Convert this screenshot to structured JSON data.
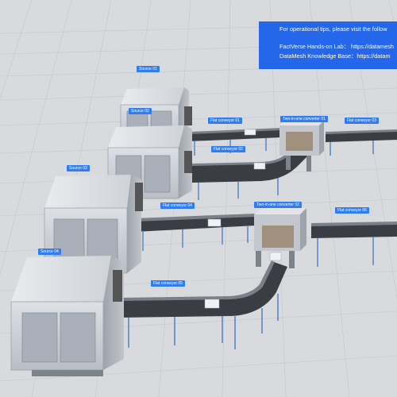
{
  "tip_panel": {
    "line1": "For operational tips, please visit the follow",
    "line2": "FactVerse Hands-on Lab： https://datamesh",
    "line3": "DataMesh Knowledge Base：https://datam"
  },
  "labels": {
    "source01": "Source 01",
    "source02": "Source 02",
    "source03": "Source 03",
    "source04": "Source 04",
    "conveyor01": "Flat conveyor 01",
    "conveyor02": "Flat conveyor 02",
    "conveyor03": "Flat conveyor 03",
    "conveyor04": "Flat conveyor 04",
    "conveyor05": "Flat conveyor 05",
    "conveyor06": "Flat conveyor 06",
    "converter01": "Two-in-one converter 01",
    "converter02": "Two-in-one converter 02"
  },
  "colors": {
    "background": "#d9dadd",
    "grid": "#c4c6ca",
    "label_bg": "#2f7df0",
    "panel_bg": "#2567ea",
    "machine_body": "#c8ccd3",
    "belt": "#2f3338",
    "frame": "#4d82c7",
    "box": "#eef1f5"
  }
}
